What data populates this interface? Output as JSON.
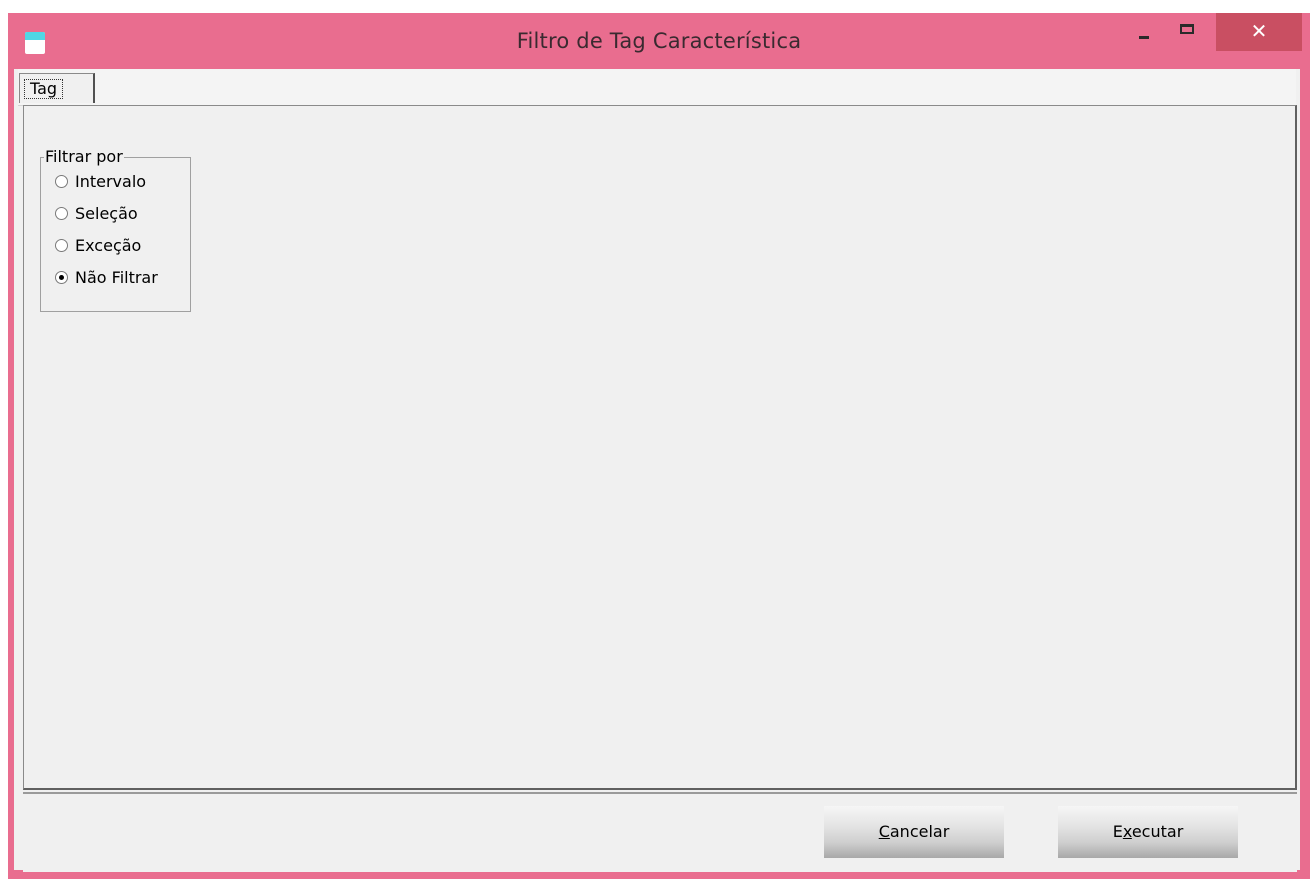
{
  "window": {
    "title": "Filtro de Tag Característica",
    "close_glyph": "✕",
    "accent_color": "#e96d8f",
    "close_color": "#c94f62"
  },
  "tabs": [
    {
      "label": "Tag",
      "selected": true
    }
  ],
  "filter_group": {
    "legend": "Filtrar por",
    "options": [
      {
        "label": "Intervalo",
        "checked": false
      },
      {
        "label": "Seleção",
        "checked": false
      },
      {
        "label": "Exceção",
        "checked": false
      },
      {
        "label": "Não Filtrar",
        "checked": true
      }
    ]
  },
  "buttons": {
    "cancel_label": "Cancelar",
    "cancel_mnemonic": "C",
    "execute_label": "Executar",
    "execute_mnemonic": "x"
  }
}
